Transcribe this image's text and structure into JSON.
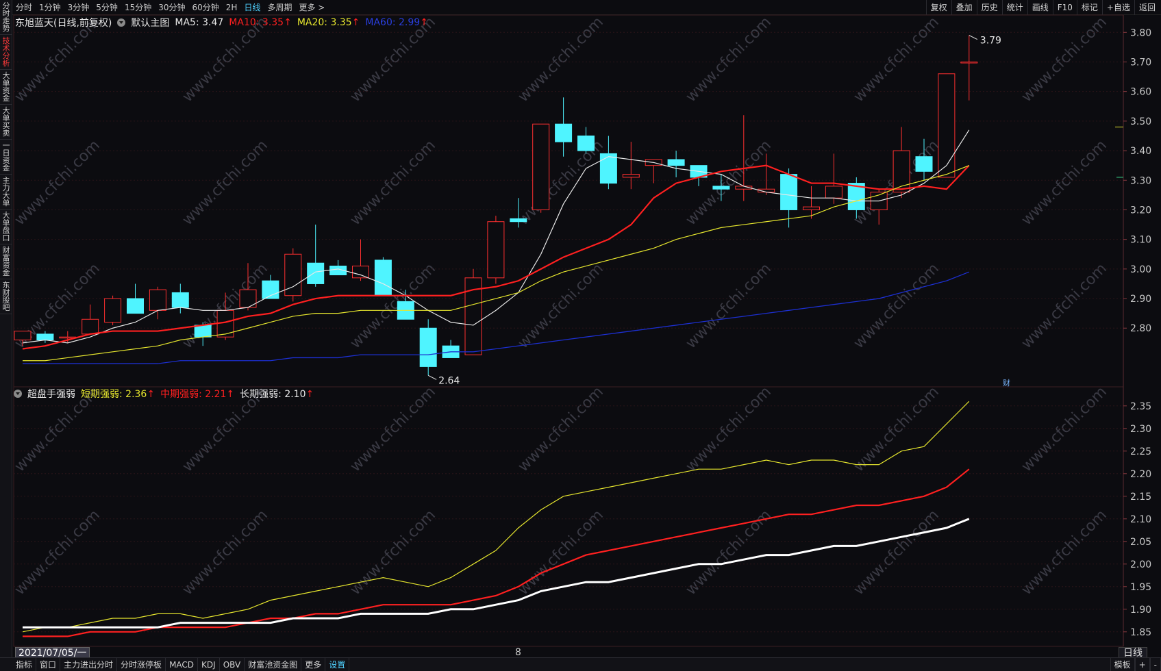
{
  "sidebar": {
    "tabs": [
      {
        "label": "分时走势",
        "active": false
      },
      {
        "label": "技术分析",
        "active": true
      },
      {
        "label": "大单资金",
        "active": false
      },
      {
        "label": "大单买卖",
        "active": false
      },
      {
        "label": "一日资金",
        "active": false
      },
      {
        "label": "主力大单",
        "active": false
      },
      {
        "label": "大单盘口",
        "active": false
      },
      {
        "label": "财富资金",
        "active": false
      },
      {
        "label": "东财股吧",
        "active": false
      }
    ]
  },
  "toolbar": {
    "periods": [
      "分时",
      "1分钟",
      "3分钟",
      "5分钟",
      "15分钟",
      "30分钟",
      "60分钟",
      "2H",
      "日线",
      "多周期",
      "更多 >"
    ],
    "active_period": "日线",
    "tools": [
      "复权",
      "叠加",
      "历史",
      "统计",
      "画线",
      "F10",
      "标记",
      "+自选",
      "返回"
    ]
  },
  "main_legend": {
    "stock_name": "东旭蓝天(日线,前复权)",
    "template": "默认主图",
    "ma5": "MA5: 3.47",
    "ma10": "MA10: 3.35",
    "ma20": "MA20: 3.35",
    "ma60": "MA60: 2.99",
    "arrow": "↑"
  },
  "sub_legend": {
    "indicator": "超盘手强弱",
    "short": "短期强弱: 2.36",
    "mid": "中期强弱: 2.21",
    "long": "长期强弱: 2.10",
    "arrow": "↑"
  },
  "colors": {
    "up": "#ff3030",
    "down": "#4ff4ff",
    "ma5": "#e8e8e8",
    "ma10": "#ff2020",
    "ma20": "#e6e62e",
    "ma60": "#1c2fd0",
    "short": "#e6e62e",
    "mid": "#ff2020",
    "long": "#ffffff",
    "watermark": "#3a3a44"
  },
  "watermark": "www.cfchi.com",
  "price_axis": [
    "3.80",
    "3.70",
    "3.60",
    "3.50",
    "3.40",
    "3.30",
    "3.20",
    "3.10",
    "3.00",
    "2.90",
    "2.80"
  ],
  "sub_axis": [
    "2.35",
    "2.30",
    "2.25",
    "2.20",
    "2.15",
    "2.10",
    "2.05",
    "2.00",
    "1.95",
    "1.90",
    "1.85"
  ],
  "annotations": {
    "high": "3.79",
    "low": "2.64",
    "cai": "财"
  },
  "bottom": {
    "date_cursor": "2021/07/05/一",
    "date_tick": "8",
    "period_tag": "日线",
    "tabs": [
      "指标",
      "窗口",
      "主力进出分时",
      "分时涨停板",
      "MACD",
      "KDJ",
      "OBV",
      "财富池资金图",
      "更多",
      "设置"
    ],
    "highlight_tab": "设置",
    "right": [
      "模板",
      "+",
      "-"
    ]
  },
  "chart_data": [
    {
      "type": "candlestick",
      "title": "东旭蓝天(日线,前复权)",
      "ylim": [
        2.62,
        3.84
      ],
      "candles": [
        {
          "o": 2.76,
          "h": 2.79,
          "l": 2.74,
          "c": 2.79
        },
        {
          "o": 2.78,
          "h": 2.79,
          "l": 2.75,
          "c": 2.76
        },
        {
          "o": 2.77,
          "h": 2.79,
          "l": 2.75,
          "c": 2.77
        },
        {
          "o": 2.78,
          "h": 2.88,
          "l": 2.78,
          "c": 2.83
        },
        {
          "o": 2.82,
          "h": 2.91,
          "l": 2.81,
          "c": 2.9
        },
        {
          "o": 2.9,
          "h": 2.95,
          "l": 2.85,
          "c": 2.85
        },
        {
          "o": 2.86,
          "h": 2.94,
          "l": 2.83,
          "c": 2.93
        },
        {
          "o": 2.92,
          "h": 2.95,
          "l": 2.85,
          "c": 2.87
        },
        {
          "o": 2.81,
          "h": 2.82,
          "l": 2.74,
          "c": 2.77
        },
        {
          "o": 2.77,
          "h": 2.92,
          "l": 2.76,
          "c": 2.86
        },
        {
          "o": 2.87,
          "h": 3.02,
          "l": 2.86,
          "c": 2.93
        },
        {
          "o": 2.96,
          "h": 2.98,
          "l": 2.9,
          "c": 2.9
        },
        {
          "o": 2.91,
          "h": 3.07,
          "l": 2.89,
          "c": 3.05
        },
        {
          "o": 3.02,
          "h": 3.15,
          "l": 2.94,
          "c": 2.95
        },
        {
          "o": 3.01,
          "h": 3.03,
          "l": 2.98,
          "c": 2.98
        },
        {
          "o": 2.97,
          "h": 3.1,
          "l": 2.96,
          "c": 3.01
        },
        {
          "o": 3.03,
          "h": 3.04,
          "l": 2.91,
          "c": 2.91
        },
        {
          "o": 2.89,
          "h": 2.93,
          "l": 2.83,
          "c": 2.83
        },
        {
          "o": 2.8,
          "h": 2.83,
          "l": 2.64,
          "c": 2.67
        },
        {
          "o": 2.74,
          "h": 2.76,
          "l": 2.71,
          "c": 2.7
        },
        {
          "o": 2.71,
          "h": 3.0,
          "l": 2.71,
          "c": 2.97
        },
        {
          "o": 2.97,
          "h": 3.18,
          "l": 2.95,
          "c": 3.16
        },
        {
          "o": 3.17,
          "h": 3.24,
          "l": 3.14,
          "c": 3.16
        },
        {
          "o": 3.2,
          "h": 3.49,
          "l": 3.19,
          "c": 3.49
        },
        {
          "o": 3.49,
          "h": 3.58,
          "l": 3.38,
          "c": 3.43
        },
        {
          "o": 3.45,
          "h": 3.48,
          "l": 3.39,
          "c": 3.4
        },
        {
          "o": 3.39,
          "h": 3.45,
          "l": 3.27,
          "c": 3.29
        },
        {
          "o": 3.31,
          "h": 3.43,
          "l": 3.27,
          "c": 3.32
        },
        {
          "o": 3.35,
          "h": 3.37,
          "l": 3.29,
          "c": 3.37
        },
        {
          "o": 3.37,
          "h": 3.4,
          "l": 3.31,
          "c": 3.35
        },
        {
          "o": 3.35,
          "h": 3.35,
          "l": 3.28,
          "c": 3.31
        },
        {
          "o": 3.28,
          "h": 3.32,
          "l": 3.23,
          "c": 3.27
        },
        {
          "o": 3.27,
          "h": 3.52,
          "l": 3.23,
          "c": 3.28
        },
        {
          "o": 3.26,
          "h": 3.39,
          "l": 3.25,
          "c": 3.27
        },
        {
          "o": 3.32,
          "h": 3.34,
          "l": 3.14,
          "c": 3.2
        },
        {
          "o": 3.2,
          "h": 3.28,
          "l": 3.17,
          "c": 3.21
        },
        {
          "o": 3.24,
          "h": 3.39,
          "l": 3.22,
          "c": 3.28
        },
        {
          "o": 3.29,
          "h": 3.31,
          "l": 3.17,
          "c": 3.2
        },
        {
          "o": 3.2,
          "h": 3.27,
          "l": 3.15,
          "c": 3.26
        },
        {
          "o": 3.26,
          "h": 3.48,
          "l": 3.24,
          "c": 3.4
        },
        {
          "o": 3.38,
          "h": 3.44,
          "l": 3.3,
          "c": 3.33
        },
        {
          "o": 3.31,
          "h": 3.66,
          "l": 3.31,
          "c": 3.66
        },
        {
          "o": 3.7,
          "h": 3.79,
          "l": 3.57,
          "c": 3.7
        }
      ],
      "series": [
        {
          "name": "MA5",
          "values": [
            2.75,
            2.76,
            2.75,
            2.77,
            2.8,
            2.82,
            2.86,
            2.87,
            2.86,
            2.86,
            2.87,
            2.91,
            2.94,
            2.99,
            3.0,
            2.98,
            2.95,
            2.91,
            2.86,
            2.82,
            2.81,
            2.86,
            2.92,
            3.05,
            3.22,
            3.34,
            3.38,
            3.37,
            3.36,
            3.34,
            3.33,
            3.32,
            3.28,
            3.26,
            3.25,
            3.24,
            3.24,
            3.23,
            3.23,
            3.25,
            3.29,
            3.35,
            3.47
          ]
        },
        {
          "name": "MA10",
          "values": [
            2.73,
            2.74,
            2.76,
            2.78,
            2.79,
            2.79,
            2.79,
            2.8,
            2.81,
            2.82,
            2.84,
            2.85,
            2.88,
            2.9,
            2.91,
            2.91,
            2.91,
            2.91,
            2.91,
            2.91,
            2.93,
            2.94,
            2.96,
            3.0,
            3.04,
            3.07,
            3.1,
            3.15,
            3.24,
            3.29,
            3.31,
            3.33,
            3.34,
            3.35,
            3.32,
            3.29,
            3.29,
            3.28,
            3.27,
            3.27,
            3.28,
            3.27,
            3.35
          ]
        },
        {
          "name": "MA20",
          "values": [
            2.69,
            2.69,
            2.7,
            2.71,
            2.72,
            2.73,
            2.74,
            2.76,
            2.77,
            2.78,
            2.8,
            2.82,
            2.84,
            2.85,
            2.85,
            2.86,
            2.86,
            2.86,
            2.86,
            2.86,
            2.88,
            2.9,
            2.92,
            2.96,
            2.99,
            3.01,
            3.03,
            3.05,
            3.07,
            3.1,
            3.12,
            3.14,
            3.15,
            3.16,
            3.17,
            3.18,
            3.21,
            3.23,
            3.25,
            3.28,
            3.3,
            3.32,
            3.35
          ]
        },
        {
          "name": "MA60",
          "values": [
            2.68,
            2.68,
            2.68,
            2.68,
            2.68,
            2.68,
            2.68,
            2.69,
            2.69,
            2.69,
            2.69,
            2.69,
            2.7,
            2.7,
            2.7,
            2.71,
            2.71,
            2.71,
            2.71,
            2.72,
            2.72,
            2.73,
            2.74,
            2.75,
            2.76,
            2.77,
            2.78,
            2.79,
            2.8,
            2.81,
            2.82,
            2.83,
            2.84,
            2.85,
            2.86,
            2.87,
            2.88,
            2.89,
            2.9,
            2.92,
            2.94,
            2.96,
            2.99
          ]
        }
      ]
    },
    {
      "type": "line",
      "title": "超盘手强弱",
      "ylim": [
        1.83,
        2.38
      ],
      "series": [
        {
          "name": "短期强弱",
          "values": [
            1.85,
            1.86,
            1.86,
            1.87,
            1.88,
            1.88,
            1.89,
            1.89,
            1.88,
            1.89,
            1.9,
            1.92,
            1.93,
            1.94,
            1.95,
            1.96,
            1.97,
            1.96,
            1.95,
            1.97,
            2.0,
            2.03,
            2.08,
            2.12,
            2.15,
            2.16,
            2.17,
            2.18,
            2.19,
            2.2,
            2.21,
            2.21,
            2.22,
            2.23,
            2.22,
            2.23,
            2.23,
            2.22,
            2.22,
            2.25,
            2.26,
            2.31,
            2.36
          ]
        },
        {
          "name": "中期强弱",
          "values": [
            1.84,
            1.84,
            1.84,
            1.85,
            1.85,
            1.85,
            1.86,
            1.86,
            1.86,
            1.86,
            1.87,
            1.88,
            1.88,
            1.89,
            1.89,
            1.9,
            1.91,
            1.91,
            1.91,
            1.91,
            1.92,
            1.93,
            1.95,
            1.98,
            2.0,
            2.02,
            2.03,
            2.04,
            2.05,
            2.06,
            2.07,
            2.08,
            2.09,
            2.1,
            2.11,
            2.11,
            2.12,
            2.13,
            2.13,
            2.14,
            2.15,
            2.17,
            2.21
          ]
        },
        {
          "name": "长期强弱",
          "values": [
            1.86,
            1.86,
            1.86,
            1.86,
            1.86,
            1.86,
            1.86,
            1.87,
            1.87,
            1.87,
            1.87,
            1.87,
            1.88,
            1.88,
            1.88,
            1.89,
            1.89,
            1.89,
            1.89,
            1.9,
            1.9,
            1.91,
            1.92,
            1.94,
            1.95,
            1.96,
            1.96,
            1.97,
            1.98,
            1.99,
            2.0,
            2.0,
            2.01,
            2.02,
            2.02,
            2.03,
            2.04,
            2.04,
            2.05,
            2.06,
            2.07,
            2.08,
            2.1
          ]
        }
      ]
    }
  ]
}
